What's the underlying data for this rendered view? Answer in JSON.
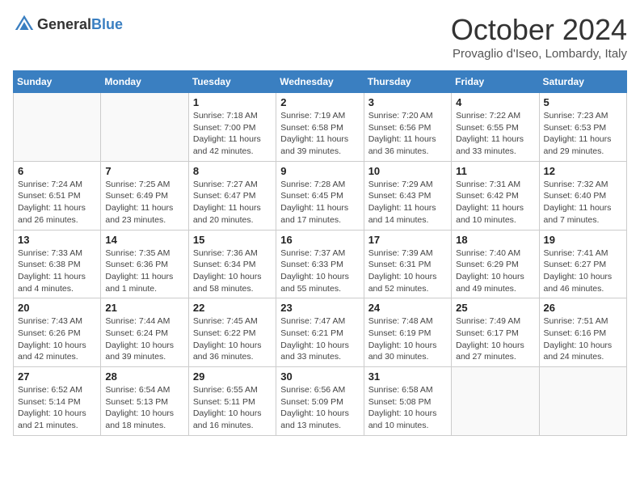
{
  "header": {
    "logo_general": "General",
    "logo_blue": "Blue",
    "month": "October 2024",
    "location": "Provaglio d'Iseo, Lombardy, Italy"
  },
  "days_of_week": [
    "Sunday",
    "Monday",
    "Tuesday",
    "Wednesday",
    "Thursday",
    "Friday",
    "Saturday"
  ],
  "weeks": [
    [
      {
        "day": "",
        "info": ""
      },
      {
        "day": "",
        "info": ""
      },
      {
        "day": "1",
        "info": "Sunrise: 7:18 AM\nSunset: 7:00 PM\nDaylight: 11 hours and 42 minutes."
      },
      {
        "day": "2",
        "info": "Sunrise: 7:19 AM\nSunset: 6:58 PM\nDaylight: 11 hours and 39 minutes."
      },
      {
        "day": "3",
        "info": "Sunrise: 7:20 AM\nSunset: 6:56 PM\nDaylight: 11 hours and 36 minutes."
      },
      {
        "day": "4",
        "info": "Sunrise: 7:22 AM\nSunset: 6:55 PM\nDaylight: 11 hours and 33 minutes."
      },
      {
        "day": "5",
        "info": "Sunrise: 7:23 AM\nSunset: 6:53 PM\nDaylight: 11 hours and 29 minutes."
      }
    ],
    [
      {
        "day": "6",
        "info": "Sunrise: 7:24 AM\nSunset: 6:51 PM\nDaylight: 11 hours and 26 minutes."
      },
      {
        "day": "7",
        "info": "Sunrise: 7:25 AM\nSunset: 6:49 PM\nDaylight: 11 hours and 23 minutes."
      },
      {
        "day": "8",
        "info": "Sunrise: 7:27 AM\nSunset: 6:47 PM\nDaylight: 11 hours and 20 minutes."
      },
      {
        "day": "9",
        "info": "Sunrise: 7:28 AM\nSunset: 6:45 PM\nDaylight: 11 hours and 17 minutes."
      },
      {
        "day": "10",
        "info": "Sunrise: 7:29 AM\nSunset: 6:43 PM\nDaylight: 11 hours and 14 minutes."
      },
      {
        "day": "11",
        "info": "Sunrise: 7:31 AM\nSunset: 6:42 PM\nDaylight: 11 hours and 10 minutes."
      },
      {
        "day": "12",
        "info": "Sunrise: 7:32 AM\nSunset: 6:40 PM\nDaylight: 11 hours and 7 minutes."
      }
    ],
    [
      {
        "day": "13",
        "info": "Sunrise: 7:33 AM\nSunset: 6:38 PM\nDaylight: 11 hours and 4 minutes."
      },
      {
        "day": "14",
        "info": "Sunrise: 7:35 AM\nSunset: 6:36 PM\nDaylight: 11 hours and 1 minute."
      },
      {
        "day": "15",
        "info": "Sunrise: 7:36 AM\nSunset: 6:34 PM\nDaylight: 10 hours and 58 minutes."
      },
      {
        "day": "16",
        "info": "Sunrise: 7:37 AM\nSunset: 6:33 PM\nDaylight: 10 hours and 55 minutes."
      },
      {
        "day": "17",
        "info": "Sunrise: 7:39 AM\nSunset: 6:31 PM\nDaylight: 10 hours and 52 minutes."
      },
      {
        "day": "18",
        "info": "Sunrise: 7:40 AM\nSunset: 6:29 PM\nDaylight: 10 hours and 49 minutes."
      },
      {
        "day": "19",
        "info": "Sunrise: 7:41 AM\nSunset: 6:27 PM\nDaylight: 10 hours and 46 minutes."
      }
    ],
    [
      {
        "day": "20",
        "info": "Sunrise: 7:43 AM\nSunset: 6:26 PM\nDaylight: 10 hours and 42 minutes."
      },
      {
        "day": "21",
        "info": "Sunrise: 7:44 AM\nSunset: 6:24 PM\nDaylight: 10 hours and 39 minutes."
      },
      {
        "day": "22",
        "info": "Sunrise: 7:45 AM\nSunset: 6:22 PM\nDaylight: 10 hours and 36 minutes."
      },
      {
        "day": "23",
        "info": "Sunrise: 7:47 AM\nSunset: 6:21 PM\nDaylight: 10 hours and 33 minutes."
      },
      {
        "day": "24",
        "info": "Sunrise: 7:48 AM\nSunset: 6:19 PM\nDaylight: 10 hours and 30 minutes."
      },
      {
        "day": "25",
        "info": "Sunrise: 7:49 AM\nSunset: 6:17 PM\nDaylight: 10 hours and 27 minutes."
      },
      {
        "day": "26",
        "info": "Sunrise: 7:51 AM\nSunset: 6:16 PM\nDaylight: 10 hours and 24 minutes."
      }
    ],
    [
      {
        "day": "27",
        "info": "Sunrise: 6:52 AM\nSunset: 5:14 PM\nDaylight: 10 hours and 21 minutes."
      },
      {
        "day": "28",
        "info": "Sunrise: 6:54 AM\nSunset: 5:13 PM\nDaylight: 10 hours and 18 minutes."
      },
      {
        "day": "29",
        "info": "Sunrise: 6:55 AM\nSunset: 5:11 PM\nDaylight: 10 hours and 16 minutes."
      },
      {
        "day": "30",
        "info": "Sunrise: 6:56 AM\nSunset: 5:09 PM\nDaylight: 10 hours and 13 minutes."
      },
      {
        "day": "31",
        "info": "Sunrise: 6:58 AM\nSunset: 5:08 PM\nDaylight: 10 hours and 10 minutes."
      },
      {
        "day": "",
        "info": ""
      },
      {
        "day": "",
        "info": ""
      }
    ]
  ]
}
